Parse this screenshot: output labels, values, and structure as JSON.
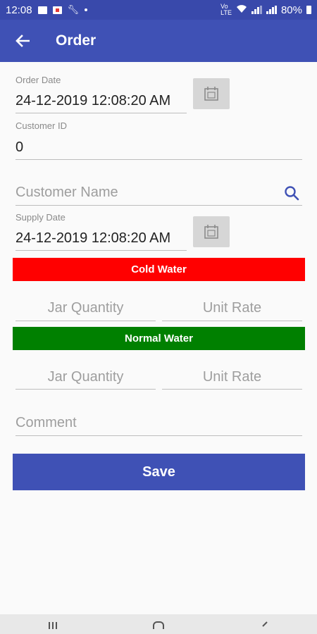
{
  "status_bar": {
    "time": "12:08",
    "battery": "80%"
  },
  "app_bar": {
    "title": "Order",
    "back_icon": "arrow-left-icon"
  },
  "form": {
    "order_date": {
      "label": "Order Date",
      "value": "24-12-2019 12:08:20 AM"
    },
    "customer_id": {
      "label": "Customer ID",
      "value": "0"
    },
    "customer_name": {
      "placeholder": "Customer Name"
    },
    "supply_date": {
      "label": "Supply Date",
      "value": "24-12-2019 12:08:20 AM"
    },
    "cold_water": {
      "title": "Cold Water",
      "color": "#ff0000",
      "jar_quantity_placeholder": "Jar Quantity",
      "unit_rate_placeholder": "Unit Rate"
    },
    "normal_water": {
      "title": "Normal Water",
      "color": "#008000",
      "jar_quantity_placeholder": "Jar Quantity",
      "unit_rate_placeholder": "Unit Rate"
    },
    "comment": {
      "placeholder": "Comment"
    },
    "save_label": "Save"
  },
  "colors": {
    "primary": "#3f51b5",
    "status_bar": "#3949ab"
  }
}
